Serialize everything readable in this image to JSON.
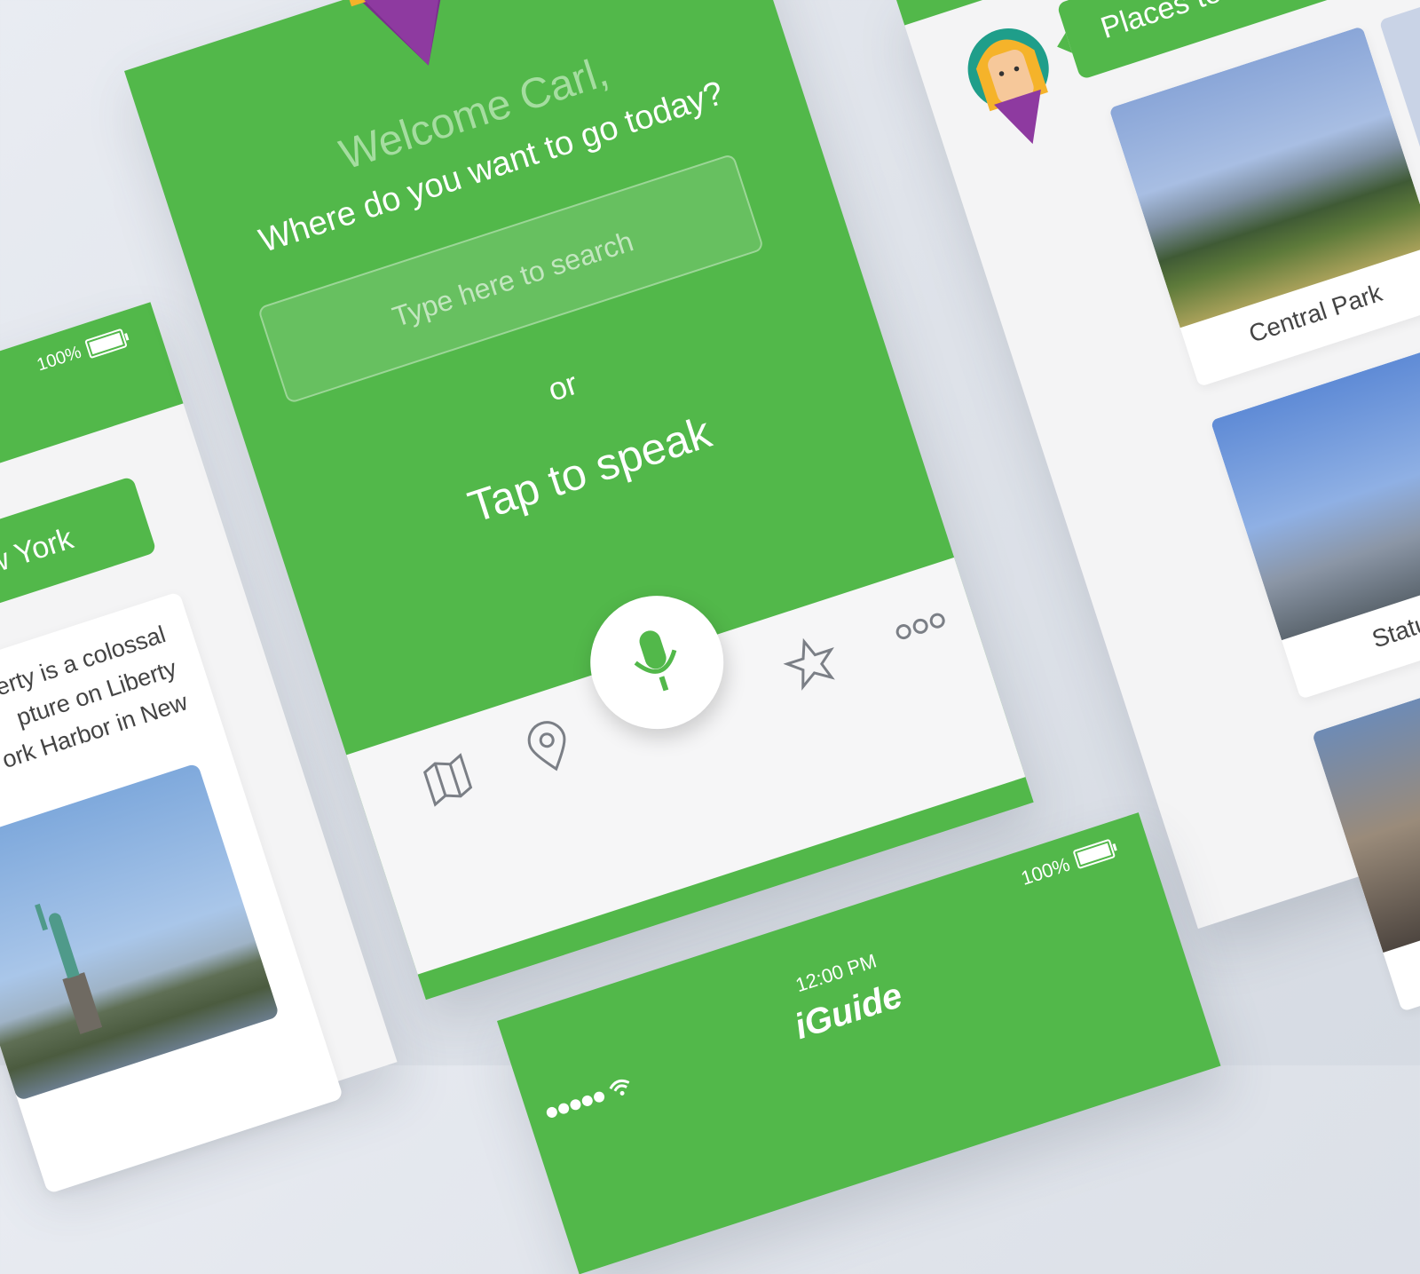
{
  "left_screen": {
    "battery": "100%",
    "bubble_text": "New York",
    "description": "erty is a colossal\npture on Liberty\nork Harbor in New"
  },
  "center_screen": {
    "welcome": "Welcome Carl,",
    "question": "Where do you want to go today?",
    "search_placeholder": "Type here to search",
    "or": "or",
    "tap_to_speak": "Tap to speak",
    "tabs": [
      "map-icon",
      "location-pin-icon",
      "microphone-icon",
      "star-icon",
      "more-icon"
    ]
  },
  "right_screen": {
    "bubble_text": "Places to visit in N",
    "places": [
      "Central Park",
      "Statue o",
      ""
    ]
  },
  "bottom_screen": {
    "battery": "100%",
    "time": "12:00 PM",
    "logo": "iGuide"
  },
  "colors": {
    "brand_green": "#52b84a",
    "background": "#e3e7ee"
  }
}
